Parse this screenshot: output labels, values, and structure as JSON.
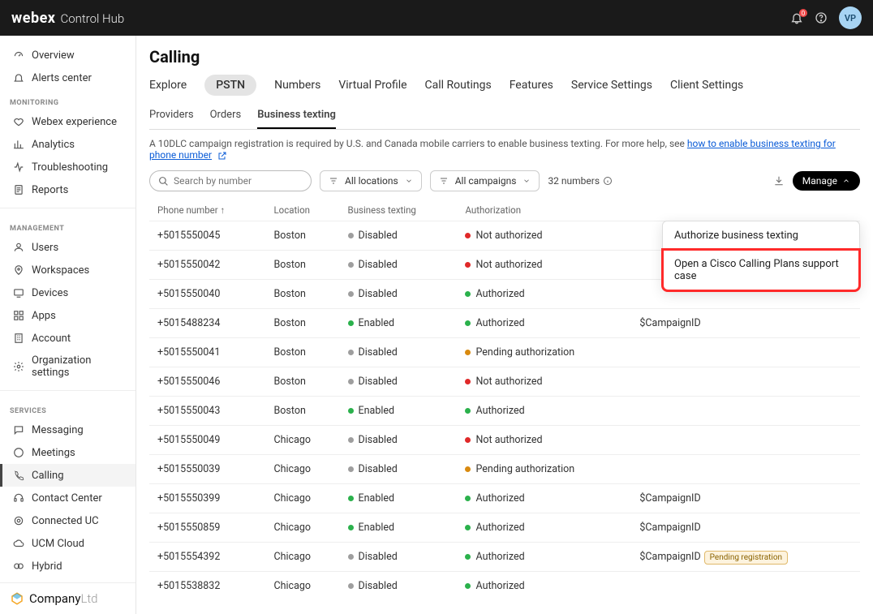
{
  "header": {
    "brand_logo": "webex",
    "brand_sub": "Control Hub",
    "avatar_initials": "VP",
    "notif_badge": "0"
  },
  "sidebar": {
    "top": [
      {
        "label": "Overview"
      },
      {
        "label": "Alerts center"
      }
    ],
    "head_monitoring": "MONITORING",
    "monitoring": [
      {
        "label": "Webex experience"
      },
      {
        "label": "Analytics"
      },
      {
        "label": "Troubleshooting"
      },
      {
        "label": "Reports"
      }
    ],
    "head_management": "MANAGEMENT",
    "management": [
      {
        "label": "Users"
      },
      {
        "label": "Workspaces"
      },
      {
        "label": "Devices"
      },
      {
        "label": "Apps"
      },
      {
        "label": "Account"
      },
      {
        "label": "Organization settings"
      }
    ],
    "head_services": "SERVICES",
    "services": [
      {
        "label": "Messaging"
      },
      {
        "label": "Meetings"
      },
      {
        "label": "Calling"
      },
      {
        "label": "Contact Center"
      },
      {
        "label": "Connected UC"
      },
      {
        "label": "UCM Cloud"
      },
      {
        "label": "Hybrid"
      }
    ],
    "company_name": "Company",
    "company_suffix": "Ltd"
  },
  "page": {
    "title": "Calling",
    "tabs": [
      "Explore",
      "PSTN",
      "Numbers",
      "Virtual Profile",
      "Call Routings",
      "Features",
      "Service Settings",
      "Client Settings"
    ],
    "subtabs": [
      "Providers",
      "Orders",
      "Business texting"
    ],
    "info_text": "A 10DLC campaign registration is required by U.S. and Canada mobile carriers to enable business texting. For more help, see ",
    "info_link": "how to enable business texting for phone number",
    "search_placeholder": "Search by number",
    "filter_locations": "All locations",
    "filter_campaigns": "All campaigns",
    "count_label": "32 numbers",
    "manage_label": "Manage",
    "columns": {
      "phone": "Phone number",
      "location": "Location",
      "texting": "Business texting",
      "auth": "Authorization"
    },
    "rows": [
      {
        "phone": "+5015550045",
        "location": "Boston",
        "texting": "Disabled",
        "t_dot": "grey",
        "auth": "Not authorized",
        "a_dot": "red",
        "campaign": ""
      },
      {
        "phone": "+5015550042",
        "location": "Boston",
        "texting": "Disabled",
        "t_dot": "grey",
        "auth": "Not authorized",
        "a_dot": "red",
        "campaign": ""
      },
      {
        "phone": "+5015550040",
        "location": "Boston",
        "texting": "Disabled",
        "t_dot": "grey",
        "auth": "Authorized",
        "a_dot": "green",
        "campaign": ""
      },
      {
        "phone": "+5015488234",
        "location": "Boston",
        "texting": "Enabled",
        "t_dot": "green",
        "auth": "Authorized",
        "a_dot": "green",
        "campaign": "$CampaignID"
      },
      {
        "phone": "+5015550041",
        "location": "Boston",
        "texting": "Disabled",
        "t_dot": "grey",
        "auth": "Pending authorization",
        "a_dot": "orange",
        "campaign": ""
      },
      {
        "phone": "+5015550046",
        "location": "Boston",
        "texting": "Disabled",
        "t_dot": "grey",
        "auth": "Not authorized",
        "a_dot": "red",
        "campaign": ""
      },
      {
        "phone": "+5015550043",
        "location": "Boston",
        "texting": "Enabled",
        "t_dot": "green",
        "auth": "Authorized",
        "a_dot": "green",
        "campaign": ""
      },
      {
        "phone": "+5015550049",
        "location": "Chicago",
        "texting": "Disabled",
        "t_dot": "grey",
        "auth": "Not authorized",
        "a_dot": "red",
        "campaign": ""
      },
      {
        "phone": "+5015550039",
        "location": "Chicago",
        "texting": "Disabled",
        "t_dot": "grey",
        "auth": "Pending authorization",
        "a_dot": "orange",
        "campaign": ""
      },
      {
        "phone": "+5015550399",
        "location": "Chicago",
        "texting": "Enabled",
        "t_dot": "green",
        "auth": "Authorized",
        "a_dot": "green",
        "campaign": "$CampaignID"
      },
      {
        "phone": "+5015550859",
        "location": "Chicago",
        "texting": "Enabled",
        "t_dot": "green",
        "auth": "Authorized",
        "a_dot": "green",
        "campaign": "$CampaignID"
      },
      {
        "phone": "+5015554392",
        "location": "Chicago",
        "texting": "Disabled",
        "t_dot": "grey",
        "auth": "Authorized",
        "a_dot": "green",
        "campaign": "$CampaignID",
        "badge": "Pending registration"
      },
      {
        "phone": "+5015538832",
        "location": "Chicago",
        "texting": "Disabled",
        "t_dot": "grey",
        "auth": "Authorized",
        "a_dot": "green",
        "campaign": ""
      }
    ],
    "dropdown": {
      "item1": "Authorize business texting",
      "item2": "Open a Cisco Calling Plans support case"
    }
  }
}
